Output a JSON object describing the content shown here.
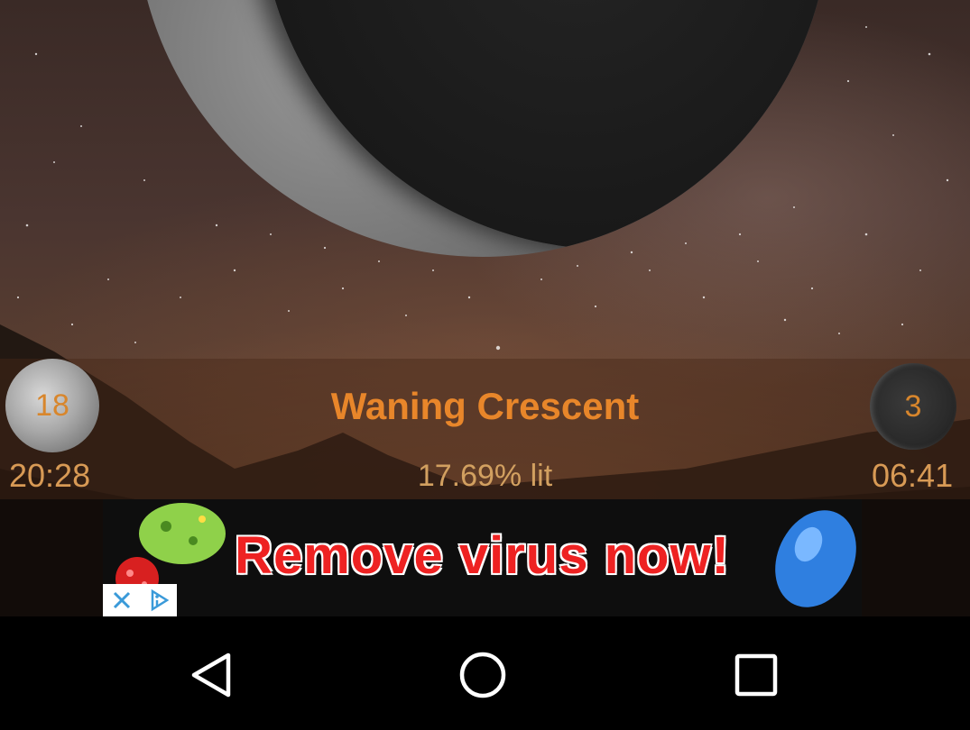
{
  "moon": {
    "phase_name": "Waning Crescent",
    "illumination": "17.69% lit",
    "previous": {
      "day": "18",
      "time": "20:28"
    },
    "next": {
      "day": "3",
      "time": "06:41"
    }
  },
  "ad": {
    "text": "Remove virus now!",
    "controls": [
      "close-icon",
      "adchoices-icon"
    ]
  },
  "navbar": {
    "buttons": [
      "back",
      "home",
      "recents"
    ]
  },
  "colors": {
    "accent": "#e8862a",
    "ad_text": "#ee2222"
  }
}
